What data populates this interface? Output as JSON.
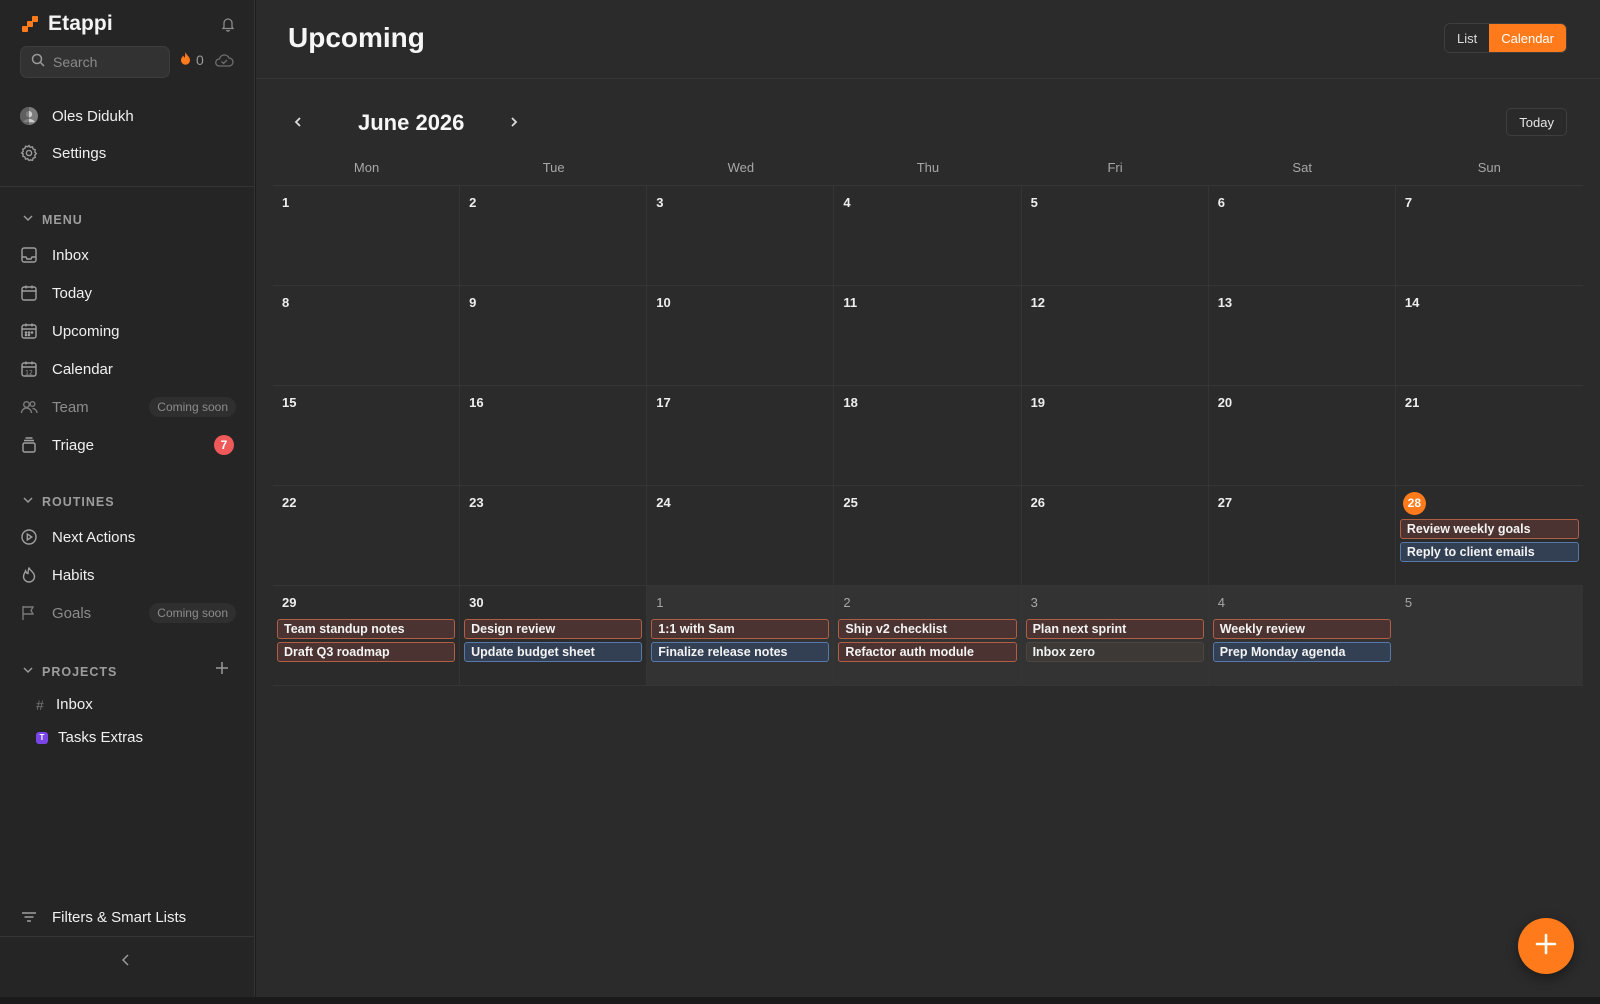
{
  "app": {
    "name": "Etappi"
  },
  "search": {
    "placeholder": "Search"
  },
  "streak": {
    "count": "0"
  },
  "user": {
    "name": "Oles Didukh"
  },
  "settings_label": "Settings",
  "sections": {
    "menu": "MENU",
    "routines": "ROUTINES",
    "projects": "PROJECTS"
  },
  "menu_items": [
    {
      "label": "Inbox",
      "icon": "inbox-icon"
    },
    {
      "label": "Today",
      "icon": "today-icon"
    },
    {
      "label": "Upcoming",
      "icon": "upcoming-icon"
    },
    {
      "label": "Calendar",
      "icon": "calendar-icon"
    },
    {
      "label": "Team",
      "icon": "team-icon",
      "tag": "Coming soon"
    },
    {
      "label": "Triage",
      "icon": "triage-icon",
      "badge": "7"
    }
  ],
  "routine_items": [
    {
      "label": "Next Actions",
      "icon": "play-circle-icon"
    },
    {
      "label": "Habits",
      "icon": "flame-icon"
    },
    {
      "label": "Goals",
      "icon": "flag-icon",
      "tag": "Coming soon"
    }
  ],
  "projects": [
    {
      "label": "Inbox",
      "marker": "#"
    },
    {
      "label": "Tasks Extras",
      "marker": "T"
    }
  ],
  "filters_label": "Filters & Smart Lists",
  "main": {
    "title": "Upcoming",
    "view_list": "List",
    "view_calendar": "Calendar",
    "month": "June 2026",
    "today_button": "Today",
    "weekdays": [
      "Mon",
      "Tue",
      "Wed",
      "Thu",
      "Fri",
      "Sat",
      "Sun"
    ]
  },
  "calendar": {
    "today": "28",
    "days": [
      {
        "n": "1"
      },
      {
        "n": "2"
      },
      {
        "n": "3"
      },
      {
        "n": "4"
      },
      {
        "n": "5"
      },
      {
        "n": "6"
      },
      {
        "n": "7"
      },
      {
        "n": "8"
      },
      {
        "n": "9"
      },
      {
        "n": "10"
      },
      {
        "n": "11"
      },
      {
        "n": "12"
      },
      {
        "n": "13"
      },
      {
        "n": "14"
      },
      {
        "n": "15"
      },
      {
        "n": "16"
      },
      {
        "n": "17"
      },
      {
        "n": "18"
      },
      {
        "n": "19"
      },
      {
        "n": "20"
      },
      {
        "n": "21"
      },
      {
        "n": "22"
      },
      {
        "n": "23"
      },
      {
        "n": "24"
      },
      {
        "n": "25"
      },
      {
        "n": "26"
      },
      {
        "n": "27"
      },
      {
        "n": "28",
        "today": true,
        "events": [
          {
            "t": "Review weekly goals",
            "c": "orange"
          },
          {
            "t": "Reply to client emails",
            "c": "blue"
          }
        ]
      },
      {
        "n": "29",
        "events": [
          {
            "t": "Team standup notes",
            "c": "orange"
          },
          {
            "t": "Draft Q3 roadmap",
            "c": "orange"
          }
        ]
      },
      {
        "n": "30",
        "events": [
          {
            "t": "Design review",
            "c": "orange"
          },
          {
            "t": "Update budget sheet",
            "c": "blue"
          }
        ]
      },
      {
        "n": "1",
        "next": true,
        "events": [
          {
            "t": "1:1 with Sam",
            "c": "orange"
          },
          {
            "t": "Finalize release notes",
            "c": "blue"
          }
        ]
      },
      {
        "n": "2",
        "next": true,
        "events": [
          {
            "t": "Ship v2 checklist",
            "c": "orange"
          },
          {
            "t": "Refactor auth module",
            "c": "orange"
          }
        ]
      },
      {
        "n": "3",
        "next": true,
        "events": [
          {
            "t": "Plan next sprint",
            "c": "orange"
          },
          {
            "t": "Inbox zero",
            "c": "gray"
          }
        ]
      },
      {
        "n": "4",
        "next": true,
        "events": [
          {
            "t": "Weekly review",
            "c": "orange"
          },
          {
            "t": "Prep Monday agenda",
            "c": "blue"
          }
        ]
      },
      {
        "n": "5",
        "next": true
      }
    ]
  },
  "colors": {
    "accent": "#ff7a1a",
    "badge": "#f0595a"
  }
}
